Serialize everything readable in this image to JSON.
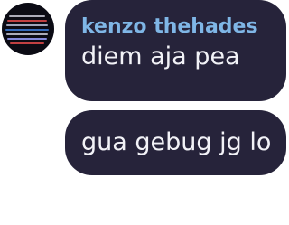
{
  "avatar": {
    "description_icon": "profile-picture-screenshot-icon",
    "colors": [
      "#ffffff",
      "#e04a4a",
      "#3b7bd8",
      "#9aa0ff"
    ]
  },
  "messages": [
    {
      "sender": "kenzo thehades",
      "text": "diem aja pea"
    },
    {
      "text": "gua gebug jg lo"
    }
  ],
  "colors": {
    "bubble": "#26233a",
    "sender": "#7fb6e6",
    "text": "#f2f2f7",
    "background": "#ffffff"
  }
}
